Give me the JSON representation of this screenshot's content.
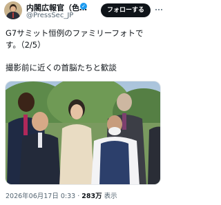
{
  "account": {
    "display_name": "内閣広報官（色…",
    "handle": "@PressSec_JP",
    "verified_mark": "✓"
  },
  "actions": {
    "follow_label": "フォローする"
  },
  "tweet": {
    "line1": "G7サミット恒例のファミリーフォトで",
    "line2": "す。（2/5）",
    "line3": "撮影前に近くの首脳たちと歓談"
  },
  "meta": {
    "date": "2026年06月17日 0:33 · ",
    "views_count": "283万",
    "views_label": " 表示"
  },
  "icons": {
    "more": "more-icon",
    "verified": "verified-badge-icon"
  },
  "colors": {
    "follow_button_bg": "#0f1419",
    "verified_blue": "#1d9bf0",
    "secondary_text": "#536471"
  }
}
